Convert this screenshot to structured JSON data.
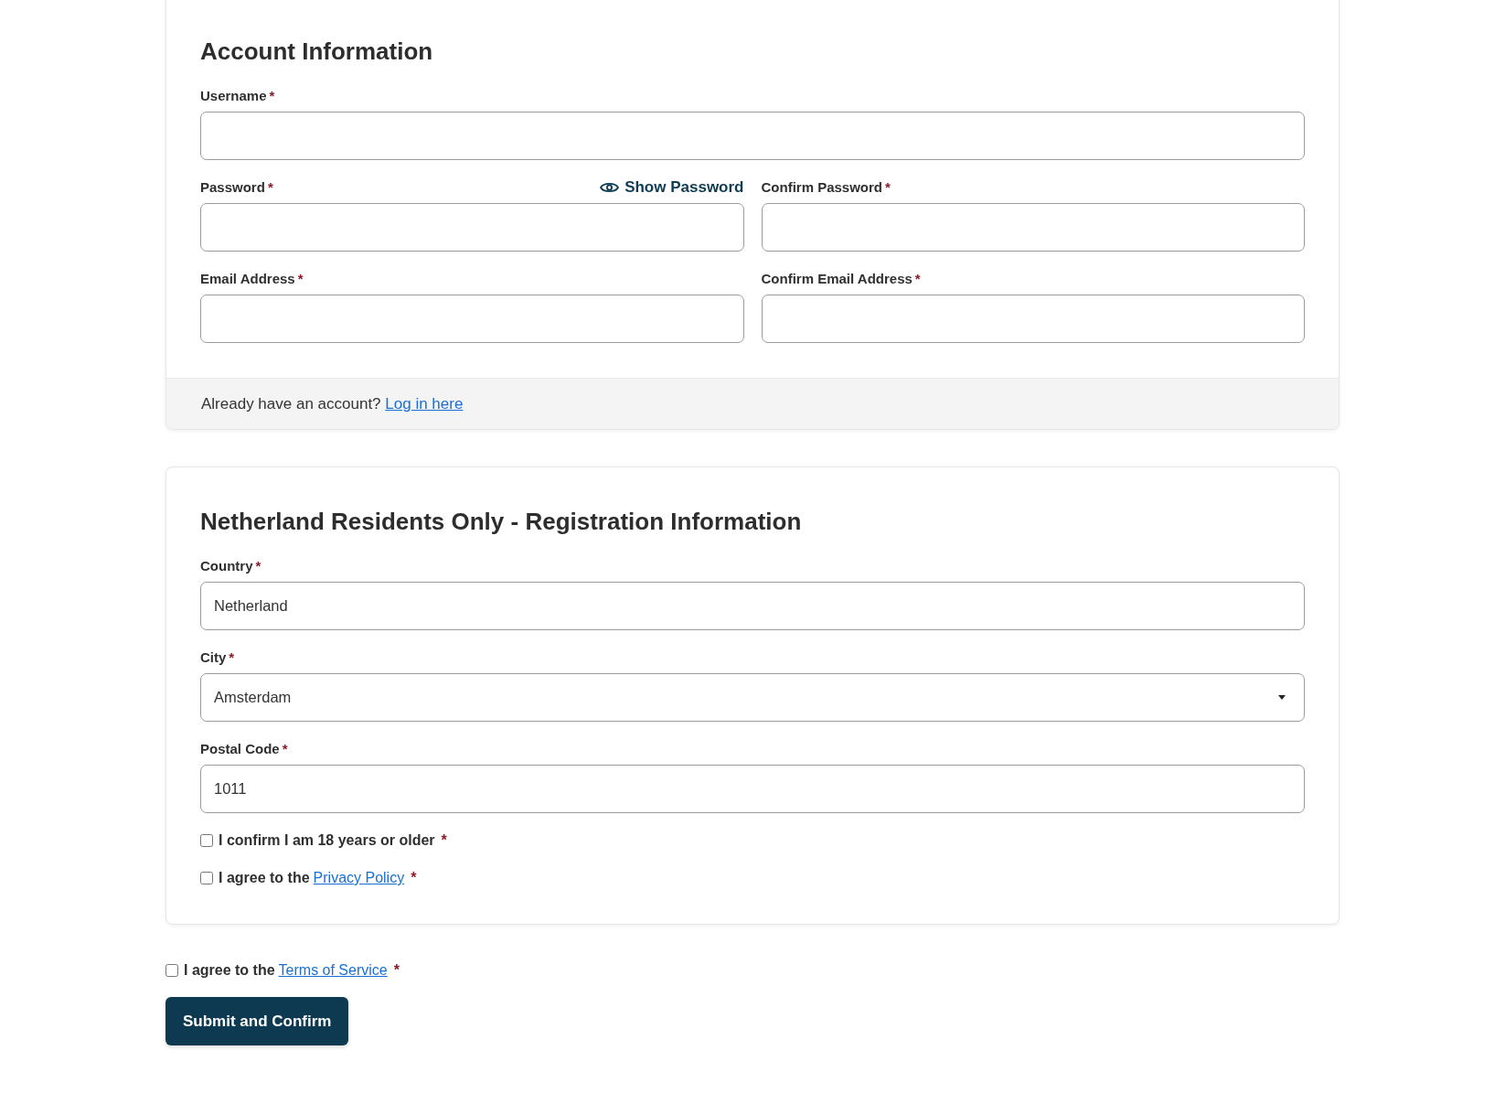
{
  "sections": [
    {
      "title": "Account Information",
      "rows": [
        {
          "fields": [
            {
              "label": "Username",
              "marker": "*",
              "kind": "text"
            }
          ]
        },
        {
          "fields": [
            {
              "label": "Password",
              "marker": "*",
              "kind": "text",
              "action": "Show Password"
            },
            {
              "label": "Confirm Password",
              "marker": "*",
              "kind": "text"
            }
          ]
        },
        {
          "fields": [
            {
              "label": "Email Address",
              "marker": "*",
              "kind": "text"
            },
            {
              "label": "Confirm Email Address",
              "marker": "*",
              "kind": "text"
            }
          ]
        }
      ],
      "footer": {
        "text": "Already have an account?",
        "link": "Log in here"
      }
    },
    {
      "title": "Netherland Residents Only - Registration Information",
      "rows": [
        {
          "fields": [
            {
              "label": "Country",
              "marker": "*",
              "kind": "text",
              "value": "Netherland"
            }
          ]
        },
        {
          "fields": [
            {
              "label": "City",
              "marker": "*",
              "kind": "select",
              "value": "Amsterdam"
            }
          ]
        },
        {
          "fields": [
            {
              "label": "Postal Code",
              "marker": "*",
              "kind": "text",
              "value": "1011"
            }
          ]
        }
      ],
      "checkboxes": [
        {
          "text": "I confirm I am 18 years or older",
          "marker": "*",
          "checked": false
        },
        {
          "text": "I agree to the",
          "link": "Privacy Policy",
          "marker": "*",
          "checked": false
        }
      ]
    }
  ],
  "terms": {
    "text": "I agree to the",
    "link": "Terms of Service",
    "marker": "*",
    "checked": false
  },
  "submit_button": "Submit and Confirm"
}
